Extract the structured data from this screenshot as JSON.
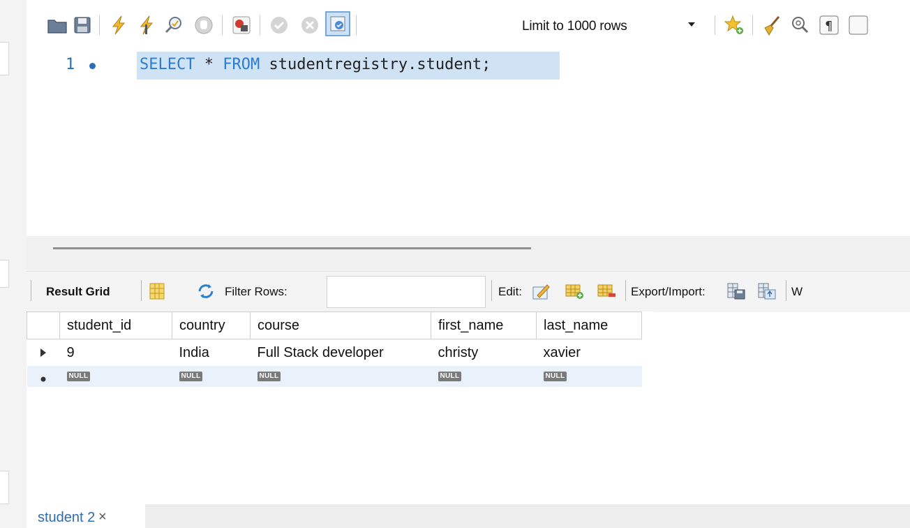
{
  "toolbar": {
    "limit_select": {
      "value": "Limit to 1000 rows"
    },
    "icons": [
      "open-folder-icon",
      "save-icon",
      "execute-icon",
      "execute-current-icon",
      "explain-icon",
      "stop-icon",
      "toggle-error-icon",
      "commit-icon",
      "rollback-icon",
      "autocommit-icon",
      "add-snippet-icon",
      "beautify-icon",
      "find-icon",
      "invisible-chars-icon",
      "wrap-icon"
    ]
  },
  "editor": {
    "line_number": "1",
    "sql_keyword_select": "SELECT",
    "sql_star": " * ",
    "sql_keyword_from": "FROM",
    "sql_rest": " studentregistry.student;"
  },
  "result_toolbar": {
    "result_grid_label": "Result Grid",
    "filter_rows_label": "Filter Rows:",
    "filter_value": "",
    "edit_label": "Edit:",
    "export_import_label": "Export/Import:",
    "wrap_label": "W"
  },
  "grid": {
    "columns": [
      "student_id",
      "country",
      "course",
      "first_name",
      "last_name"
    ],
    "rows": [
      [
        "9",
        "India",
        "Full Stack developer",
        "christy",
        "xavier"
      ]
    ],
    "new_row_marker": "NULL"
  },
  "tab": {
    "label": "student 2",
    "close": "×"
  },
  "colors": {
    "keyword": "#2b7bd0",
    "selection": "#cfe3f5",
    "tab_text": "#2e6cb0",
    "new_row": "#e9f1fb"
  }
}
